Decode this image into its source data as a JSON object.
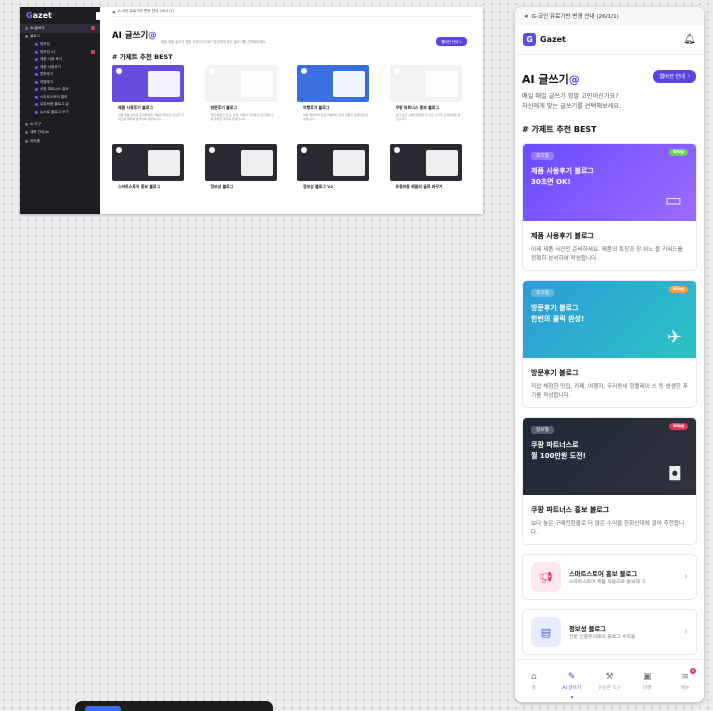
{
  "desktop": {
    "brand": {
      "prefix": "G",
      "rest": "azet"
    },
    "sidebar": {
      "items": [
        {
          "label": "AI 글쓰기",
          "badge": true,
          "active": true
        },
        {
          "label": "블로그",
          "sub": false
        }
      ],
      "subitems": [
        "정보성",
        "정보성 v2",
        "제품 사용 후기",
        "제품 사용후기",
        "방문후기",
        "여행후기",
        "쿠팡 파트너스 홍보",
        "스마트스토어 홍보",
        "유튜브용 블로그 글",
        "뉴스로 블로그 쓰기"
      ],
      "bottom_items": [
        "AI 도구",
        "대화 관리/AI",
        "마이룸"
      ]
    },
    "notice": "G-코인 유료기반 변경 안내 (26/1/1)",
    "title_prefix": "AI 글쓰기",
    "title_at": "@",
    "desc": "매일 매일 글쓰기 정말 고민이신가요? 자신에게 맞는 글쓰기를 선택해보세요.",
    "guide_button": "웹버전 안내 >",
    "section_title": "# 가제트 추천 BEST",
    "cards": [
      {
        "title": "제품 사용후기 블로그",
        "desc": "이제 제품 사진만 준비하세요. 제품의 특징과 장점을 키워드를 정확히 분석하여 작성합니다.",
        "color": "#6a4be0"
      },
      {
        "title": "방문후기 블로그",
        "desc": "직접 체험한 맛집, 카페, 여행지 우리동네 핫플레이스 등 생생한 후기를 작성합니다.",
        "color": "#f3f3f6"
      },
      {
        "title": "여행후기 블로그",
        "desc": "여행 계획부터 감성 리뷰까지 여행 경험을 생생하게 담아냅니다.",
        "color": "#3b6fe0"
      },
      {
        "title": "쿠팡 파트너스 홍보 블로그",
        "desc": "보다 높은 구매전환율로 더 많은 수익을 한화산대로 창출합니다.",
        "color": "#f2f2f5"
      },
      {
        "title": "스마트스토어 홍보 블로그",
        "desc": "",
        "color": "#2a2a33"
      },
      {
        "title": "정보성 블로그",
        "desc": "",
        "color": "#2a2a33"
      },
      {
        "title": "정보성 블로그 V2",
        "desc": "",
        "color": "#2a2a33"
      },
      {
        "title": "유튜브용 제품의 글로 바꾸기",
        "desc": "",
        "color": "#2a2a33"
      }
    ]
  },
  "mobile": {
    "notice": "G-코인 유료기반 변경 안내 (26/1/1)",
    "brand": "Gazet",
    "logo_letter": "G",
    "title_prefix": "AI 글쓰기",
    "title_at": "@",
    "guide_button": "웹버전 안내",
    "desc_line1": "매일 매일 글쓰기 정말 고민이신가요?",
    "desc_line2": "자신에게 맞는 글쓰기를 선택해보세요.",
    "section_title": "# 가제트 추천 BEST",
    "cards": [
      {
        "tag": "후기형",
        "badge": "blog",
        "headline1": "제품 사용후기 블로그",
        "headline2": "30초면 OK!",
        "title": "제품 사용후기 블로그",
        "desc": "이제 제품 사진만 준비하세요. 제품의 특징과 장·위노 을 키워드를 정확히 분석하여 작성합니다.",
        "bg": "#6b4bff",
        "bg2": "#9a6bff",
        "badge_color": "#6ad34d",
        "icon": "laptop-icon"
      },
      {
        "tag": "후기형",
        "badge": "blog",
        "headline1": "방문후기 블로그",
        "headline2": "한번의 클릭 완성!",
        "title": "방문후기 블로그",
        "desc": "직접 체험한 맛집, 카페, 여행지, 우리동네 핫플레이 스 등 생생한 후기를 작성합니다.",
        "bg": "#2e9ad8",
        "bg2": "#2bc4c4",
        "badge_color": "#f2a53b",
        "icon": "plane-icon"
      },
      {
        "tag": "정보형",
        "badge": "blog",
        "headline1": "쿠팡 파트너스로",
        "headline2": "월 100만원 도전!",
        "title": "쿠팡 파트너스 홍보 블로그",
        "desc": "보다 높은 구매전환율로 더 많은 수익을 한화산대에 걸어 추천합니다.",
        "bg": "#1f2937",
        "bg2": "#30323d",
        "badge_color": "#e0345a",
        "icon": "bag-icon"
      }
    ],
    "list": [
      {
        "title": "스마트스토어 홍보 블로그",
        "desc": "스마트스토어 제품 자동으로 홍보해 가",
        "icon": "megaphone-icon",
        "bg": "#fde7ef",
        "color": "#e0345a"
      },
      {
        "title": "정보성 블로그",
        "desc": "전문 인증주의로의 블로그 수익용",
        "icon": "document-icon",
        "bg": "#e6ecfd",
        "color": "#4565d8"
      }
    ],
    "tabs": [
      {
        "label": "홈",
        "icon": "home-icon",
        "glyph": "⌂"
      },
      {
        "label": "AI 글쓰기",
        "icon": "pen-icon",
        "glyph": "✎",
        "active": true
      },
      {
        "label": "유용한 도구",
        "icon": "wrench-icon",
        "glyph": "⚒"
      },
      {
        "label": "마켓",
        "icon": "store-icon",
        "glyph": "▣"
      },
      {
        "label": "메뉴",
        "icon": "menu-icon",
        "glyph": "≡",
        "badge": "N"
      }
    ]
  }
}
